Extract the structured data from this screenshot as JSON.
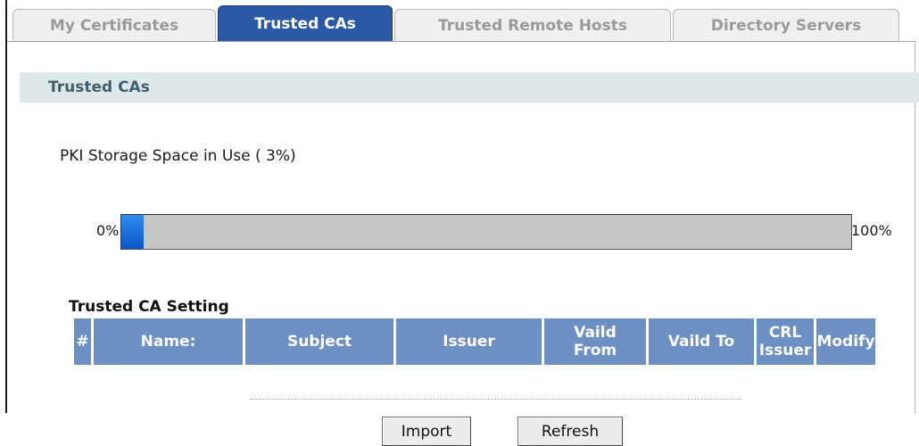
{
  "tabs": [
    {
      "label": "My Certificates",
      "active": false
    },
    {
      "label": "Trusted CAs",
      "active": true
    },
    {
      "label": "Trusted Remote Hosts",
      "active": false
    },
    {
      "label": "Directory Servers",
      "active": false
    }
  ],
  "section": {
    "title": "Trusted CAs"
  },
  "storage": {
    "label": "PKI Storage Space in Use ( 3%)",
    "min_label": "0%",
    "max_label": "100%",
    "percent_used": 3
  },
  "table": {
    "title": "Trusted CA Setting",
    "columns": [
      "#",
      "Name:",
      "Subject",
      "Issuer",
      "Vaild From",
      "Vaild To",
      "CRL Issuer",
      "Modify"
    ]
  },
  "buttons": {
    "import": "Import",
    "refresh": "Refresh"
  },
  "colors": {
    "active_tab": "#2b59a6",
    "header_bg": "#dde8e9",
    "table_header": "#6c90c4",
    "progress_fill": "#0a56c8"
  }
}
